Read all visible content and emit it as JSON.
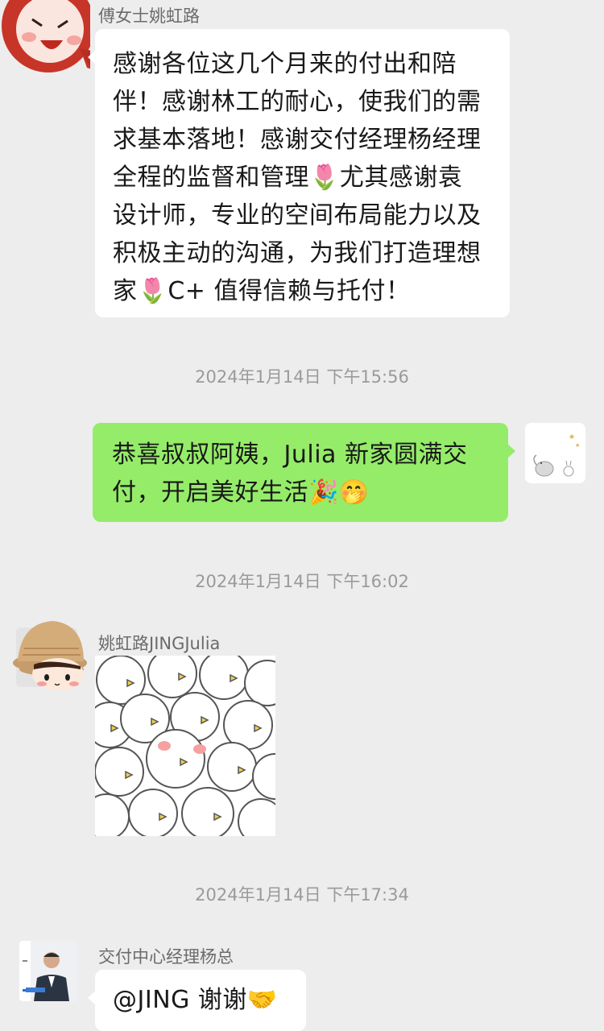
{
  "messages": [
    {
      "sender": "傅女士姚虹路",
      "text_lines": [
        "感谢各位这几个月来的付出和陪",
        "伴！感谢林工的耐心，使我们的需",
        "求基本落地！感谢交付经理杨经理",
        "全程的监督和管理🌷尤其感谢袁",
        "设计师，专业的空间布局能力以及",
        "积极主动的沟通，为我们打造理想",
        "家🌷C+ 值得信赖与托付！"
      ]
    },
    {
      "timestamp": "2024年1月14日 下午15:56"
    },
    {
      "sender": "self",
      "text_lines": [
        "恭喜叔叔阿姨，Julia 新家圆满交",
        "付，开启美好生活🎉🤭"
      ]
    },
    {
      "timestamp": "2024年1月14日 下午16:02"
    },
    {
      "sender": "姚虹路JINGJulia",
      "sticker": "crowd-of-white-birds-sticker"
    },
    {
      "timestamp": "2024年1月14日 下午17:34"
    },
    {
      "sender": "交付中心经理杨总",
      "text": "@JING  谢谢🤝"
    }
  ],
  "avatars": {
    "fu": "red-cartoon-face-icon",
    "self": "elephant-sketch-icon",
    "jing": "straw-hat-girl-icon",
    "yang": "man-in-suit-photo"
  },
  "colors": {
    "background": "#ededed",
    "bubble_in": "#ffffff",
    "bubble_out": "#95ec69"
  }
}
